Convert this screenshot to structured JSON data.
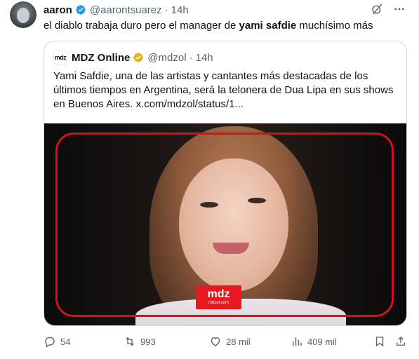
{
  "author": {
    "name": "aaron",
    "handle": "@aarontsuarez",
    "separator": "·",
    "time": "14h"
  },
  "tweet": {
    "text_before": "el diablo trabaja duro pero el manager de ",
    "text_bold": "yami safdie",
    "text_after": " muchísimo más"
  },
  "quote": {
    "logo_text": "mdz",
    "name": "MDZ Online",
    "handle": "@mdzol",
    "separator": "·",
    "time": "14h",
    "text": "Yami Safdie, una de las artistas y cantantes más destacadas de los últimos tiempos en Argentina, será la telonera de Dua Lipa en sus shows en Buenos Aires.  x.com/mdzol/status/1...",
    "image_badge_main": "mdz",
    "image_badge_sub": "mdzol.com"
  },
  "actions": {
    "replies": "54",
    "reposts": "993",
    "likes": "28 mil",
    "views": "409 mil"
  },
  "icons": [
    "verified-icon",
    "grok-icon",
    "more-icon",
    "gold-verified-icon",
    "reply-icon",
    "repost-icon",
    "like-icon",
    "views-icon",
    "bookmark-icon",
    "share-icon"
  ],
  "colors": {
    "verified_blue": "#1d9bf0",
    "gold": "#e2b719",
    "secondary_text": "#536471",
    "border": "#cfd9de",
    "brand_red": "#e5191f"
  }
}
